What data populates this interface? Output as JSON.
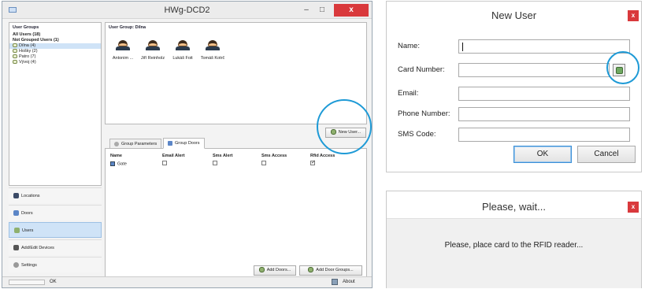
{
  "main_window": {
    "title": "HWg-DCD2",
    "min_glyph": "–",
    "max_glyph": "□",
    "close_glyph": "x",
    "tree_header": "User Groups",
    "tree_items": [
      "All Users (18)",
      "Not Grouped Users (1)",
      "Dílna (4)",
      "Hošky (2)",
      "Patro (7)",
      "Vývoj (4)"
    ],
    "group_header": "User Group: Dílna",
    "users": [
      "Antonim ...",
      "Jiří Reinholz",
      "Lukáš Foit",
      "Tomáš Kotrč"
    ],
    "new_user_button": "New User...",
    "tabs": [
      "Group Parameters",
      "Group Doors"
    ],
    "doors_table": {
      "columns": [
        "Name",
        "Email Alert",
        "Sms Alert",
        "Sms Access",
        "Rfid Access"
      ],
      "rows": [
        {
          "name": "Gate",
          "email_alert": false,
          "sms_alert": false,
          "sms_access": false,
          "rfid_access": true
        }
      ]
    },
    "add_doors_button": "Add Doors...",
    "add_door_groups_button": "Add Door Groups...",
    "nav": [
      "Locations",
      "Doors",
      "Users",
      "Add/Edit Devices",
      "Settings"
    ],
    "status_text": "OK",
    "about_label": "About"
  },
  "new_user_dialog": {
    "title": "New User",
    "close_glyph": "x",
    "labels": [
      "Name:",
      "Card Number:",
      "Email:",
      "Phone Number:",
      "SMS Code:"
    ],
    "values": [
      "",
      "",
      "",
      "",
      ""
    ],
    "ok_label": "OK",
    "cancel_label": "Cancel"
  },
  "wait_dialog": {
    "title": "Please, wait...",
    "close_glyph": "x",
    "message": "Please, place card to the RFID reader..."
  },
  "colors": {
    "highlight_circle": "#1e9ad6",
    "close_red": "#d9393c",
    "selection_blue": "#cfe3f7"
  }
}
